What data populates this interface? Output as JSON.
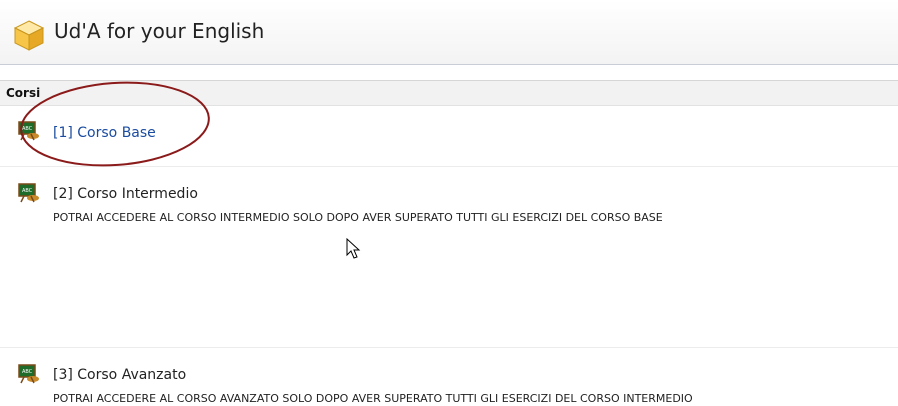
{
  "header": {
    "title": "Ud'A for your English",
    "icon": "cube-icon"
  },
  "section": {
    "label": "Corsi"
  },
  "courses": [
    {
      "title": "[1] Corso Base",
      "note": "",
      "linked": true
    },
    {
      "title": "[2] Corso Intermedio",
      "note": "POTRAI ACCEDERE AL CORSO INTERMEDIO SOLO DOPO AVER SUPERATO TUTTI GLI ESERCIZI DEL CORSO BASE",
      "linked": false
    },
    {
      "title": "[3] Corso Avanzato",
      "note": "POTRAI ACCEDERE AL CORSO AVANZATO SOLO DOPO AVER SUPERATO TUTTI GLI ESERCIZI DEL CORSO INTERMEDIO",
      "linked": false
    }
  ],
  "colors": {
    "link": "#1a4ca0",
    "annotation_ellipse": "#8b1a1a",
    "header_rule": "#c9ced6"
  }
}
